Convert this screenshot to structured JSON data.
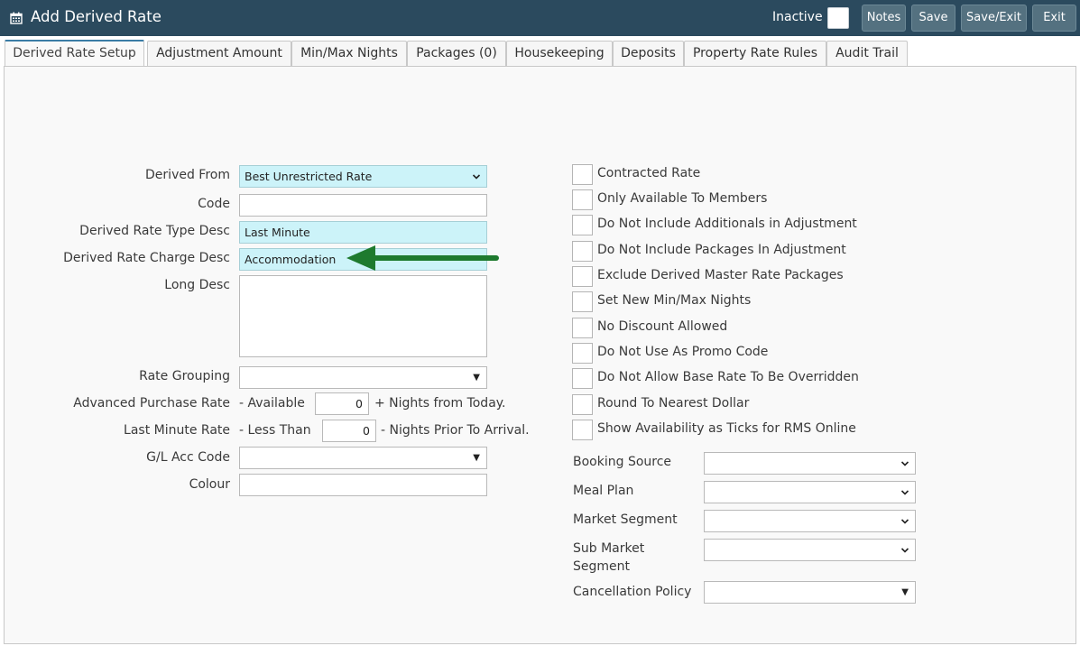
{
  "window": {
    "title": "Add Derived Rate",
    "icon": "calendar-icon",
    "inactive_label": "Inactive",
    "buttons": {
      "notes": "Notes",
      "save": "Save",
      "save_exit": "Save/Exit",
      "exit": "Exit"
    }
  },
  "tabs": [
    "Derived Rate Setup",
    "Adjustment Amount",
    "Min/Max Nights",
    "Packages (0)",
    "Housekeeping",
    "Deposits",
    "Property Rate Rules",
    "Audit Trail"
  ],
  "form": {
    "derived_from": {
      "label": "Derived From",
      "value": "Best Unrestricted Rate"
    },
    "code": {
      "label": "Code",
      "value": ""
    },
    "type_desc": {
      "label": "Derived Rate Type Desc",
      "value": "Last Minute"
    },
    "charge_desc": {
      "label": "Derived Rate Charge Desc",
      "value": "Accommodation"
    },
    "long_desc": {
      "label": "Long Desc",
      "value": ""
    },
    "rate_grouping": {
      "label": "Rate Grouping",
      "value": ""
    },
    "advanced_purchase": {
      "label": "Advanced Purchase Rate",
      "prefix": "- Available",
      "value": "0",
      "suffix": "+ Nights from Today."
    },
    "last_minute": {
      "label": "Last Minute Rate",
      "prefix": "- Less Than",
      "value": "0",
      "suffix": "- Nights Prior To Arrival."
    },
    "gl_acc_code": {
      "label": "G/L Acc Code",
      "value": ""
    },
    "colour": {
      "label": "Colour",
      "value": ""
    }
  },
  "checkboxes": [
    {
      "label": "Contracted Rate",
      "checked": false
    },
    {
      "label": "Only Available To Members",
      "checked": false
    },
    {
      "label": "Do Not Include Additionals in Adjustment",
      "checked": false
    },
    {
      "label": "Do Not Include Packages In Adjustment",
      "checked": false
    },
    {
      "label": "Exclude Derived Master Rate Packages",
      "checked": false
    },
    {
      "label": "Set New Min/Max Nights",
      "checked": false
    },
    {
      "label": "No Discount Allowed",
      "checked": false
    },
    {
      "label": "Do Not Use As Promo Code",
      "checked": false
    },
    {
      "label": "Do Not Allow Base Rate To Be Overridden",
      "checked": false
    },
    {
      "label": "Round To Nearest Dollar",
      "checked": false
    },
    {
      "label": "Show Availability as Ticks for RMS Online",
      "checked": false
    }
  ],
  "right_selects": {
    "booking_source": {
      "label": "Booking Source",
      "value": ""
    },
    "meal_plan": {
      "label": "Meal Plan",
      "value": ""
    },
    "market_segment": {
      "label": "Market Segment",
      "value": ""
    },
    "sub_market_segment": {
      "label_line1": "Sub Market",
      "label_line2": "Segment",
      "value": ""
    },
    "cancellation_policy": {
      "label": "Cancellation Policy",
      "value": ""
    }
  },
  "annotation": {
    "arrow_color": "#1e7a2e"
  },
  "colors": {
    "titlebar": "#2b4a5e",
    "button": "#547180",
    "highlight_field": "#ccf3f9",
    "active_tab_border": "#3a7ca5"
  }
}
